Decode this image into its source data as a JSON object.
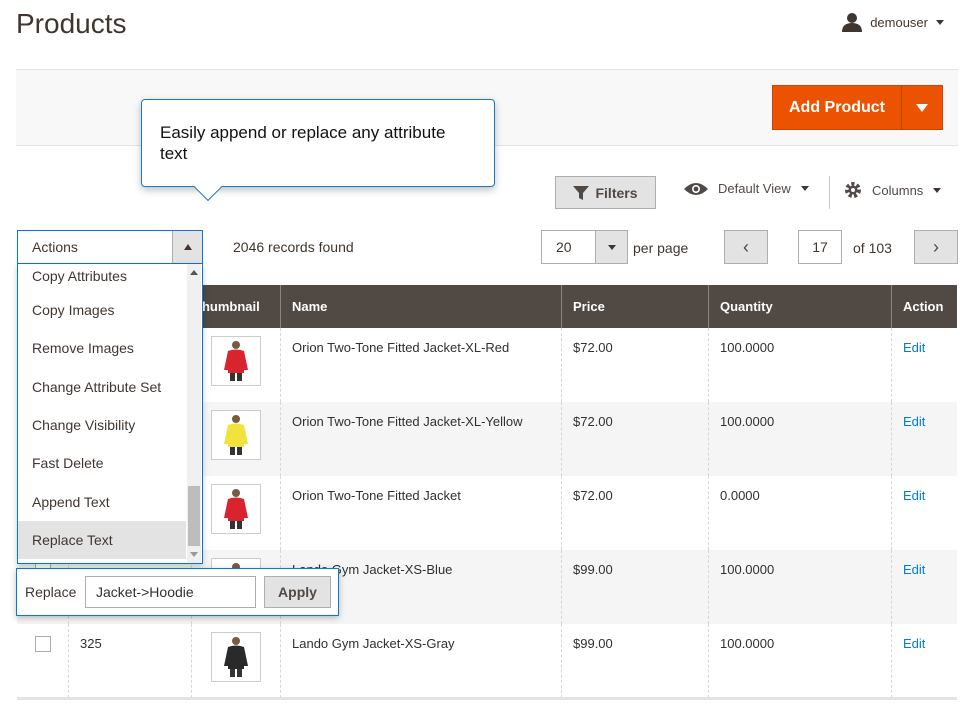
{
  "page": {
    "title": "Products"
  },
  "user": {
    "name": "demouser"
  },
  "toolbar": {
    "add_product_label": "Add Product"
  },
  "callout": {
    "text": "Easily append or replace any attribute text"
  },
  "grid_controls": {
    "filters_label": "Filters",
    "view_label": "Default View",
    "columns_label": "Columns",
    "actions_label": "Actions",
    "records_text": "2046 records found",
    "per_page_value": "20",
    "per_page_label": "per page",
    "current_page": "17",
    "page_of": "of 103"
  },
  "actions_menu": {
    "items": [
      {
        "label": "Copy Attributes"
      },
      {
        "label": "Copy Images"
      },
      {
        "label": "Remove Images"
      },
      {
        "label": "Change Attribute Set"
      },
      {
        "label": "Change Visibility"
      },
      {
        "label": "Fast Delete"
      },
      {
        "label": "Append Text"
      },
      {
        "label": "Replace Text"
      }
    ]
  },
  "replace_panel": {
    "label": "Replace",
    "value": "Jacket->Hoodie",
    "apply_label": "Apply"
  },
  "table": {
    "headers": {
      "thumbnail": "Thumbnail",
      "name": "Name",
      "price": "Price",
      "quantity": "Quantity",
      "action": "Action"
    },
    "rows": [
      {
        "id": "",
        "name": "Orion Two-Tone Fitted Jacket-XL-Red",
        "price": "$72.00",
        "qty": "100.0000",
        "action": "Edit",
        "jacket_color": "#d9232e"
      },
      {
        "id": "",
        "name": "Orion Two-Tone Fitted Jacket-XL-Yellow",
        "price": "$72.00",
        "qty": "100.0000",
        "action": "Edit",
        "jacket_color": "#f0e33c"
      },
      {
        "id": "",
        "name": "Orion Two-Tone Fitted Jacket",
        "price": "$72.00",
        "qty": "0.0000",
        "action": "Edit",
        "jacket_color": "#d9232e"
      },
      {
        "id": "",
        "name": "Lando Gym Jacket-XS-Blue",
        "price": "$99.00",
        "qty": "100.0000",
        "action": "Edit",
        "jacket_color": "#2b4fa0"
      },
      {
        "id": "325",
        "name": "Lando Gym Jacket-XS-Gray",
        "price": "$99.00",
        "qty": "100.0000",
        "action": "Edit",
        "jacket_color": "#2a2a2a"
      }
    ]
  },
  "colors": {
    "accent": "#eb5202",
    "header_bg": "#514943",
    "link": "#007bdb",
    "focus_border": "#007bdb"
  }
}
